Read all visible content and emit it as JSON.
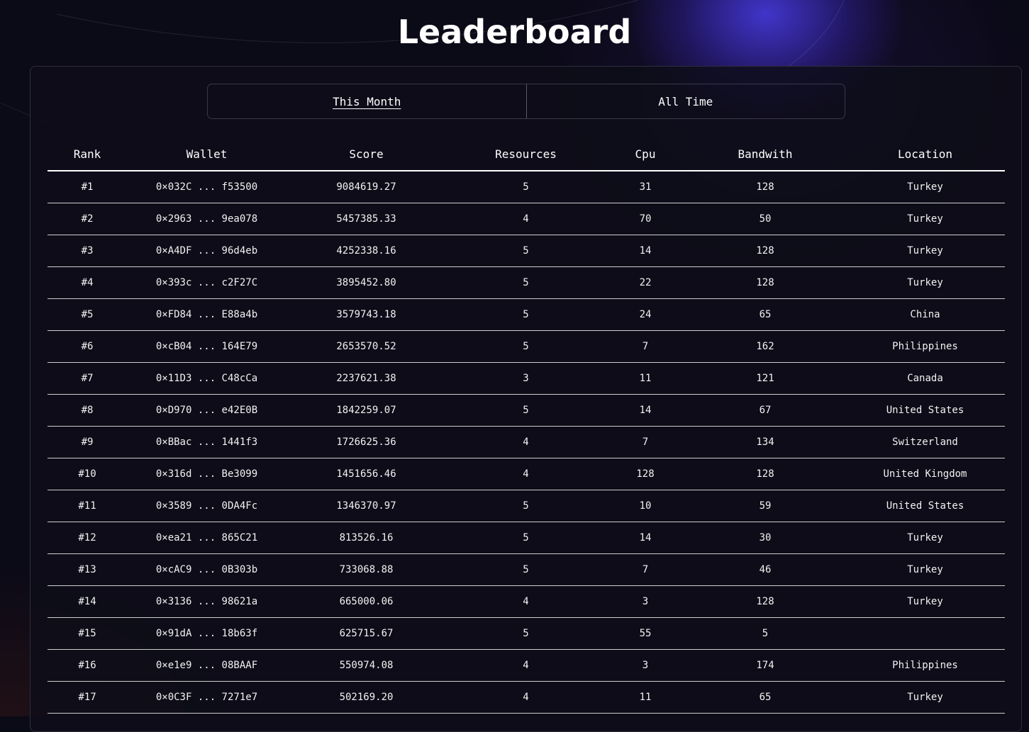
{
  "title": "Leaderboard",
  "tabs": [
    {
      "label": "This Month",
      "active": true
    },
    {
      "label": "All Time",
      "active": false
    }
  ],
  "columns": [
    "Rank",
    "Wallet",
    "Score",
    "Resources",
    "Cpu",
    "Bandwith",
    "Location"
  ],
  "rows": [
    {
      "rank": "#1",
      "wallet": "0×032C ... f53500",
      "score": "9084619.27",
      "resources": "5",
      "cpu": "31",
      "bandwith": "128",
      "location": "Turkey"
    },
    {
      "rank": "#2",
      "wallet": "0×2963 ... 9ea078",
      "score": "5457385.33",
      "resources": "4",
      "cpu": "70",
      "bandwith": "50",
      "location": "Turkey"
    },
    {
      "rank": "#3",
      "wallet": "0×A4DF ... 96d4eb",
      "score": "4252338.16",
      "resources": "5",
      "cpu": "14",
      "bandwith": "128",
      "location": "Turkey"
    },
    {
      "rank": "#4",
      "wallet": "0×393c ... c2F27C",
      "score": "3895452.80",
      "resources": "5",
      "cpu": "22",
      "bandwith": "128",
      "location": "Turkey"
    },
    {
      "rank": "#5",
      "wallet": "0×FD84 ... E88a4b",
      "score": "3579743.18",
      "resources": "5",
      "cpu": "24",
      "bandwith": "65",
      "location": "China"
    },
    {
      "rank": "#6",
      "wallet": "0×cB04 ... 164E79",
      "score": "2653570.52",
      "resources": "5",
      "cpu": "7",
      "bandwith": "162",
      "location": "Philippines"
    },
    {
      "rank": "#7",
      "wallet": "0×11D3 ... C48cCa",
      "score": "2237621.38",
      "resources": "3",
      "cpu": "11",
      "bandwith": "121",
      "location": "Canada"
    },
    {
      "rank": "#8",
      "wallet": "0×D970 ... e42E0B",
      "score": "1842259.07",
      "resources": "5",
      "cpu": "14",
      "bandwith": "67",
      "location": "United States"
    },
    {
      "rank": "#9",
      "wallet": "0×BBac ... 1441f3",
      "score": "1726625.36",
      "resources": "4",
      "cpu": "7",
      "bandwith": "134",
      "location": "Switzerland"
    },
    {
      "rank": "#10",
      "wallet": "0×316d ... Be3099",
      "score": "1451656.46",
      "resources": "4",
      "cpu": "128",
      "bandwith": "128",
      "location": "United Kingdom"
    },
    {
      "rank": "#11",
      "wallet": "0×3589 ... 0DA4Fc",
      "score": "1346370.97",
      "resources": "5",
      "cpu": "10",
      "bandwith": "59",
      "location": "United States"
    },
    {
      "rank": "#12",
      "wallet": "0×ea21 ... 865C21",
      "score": "813526.16",
      "resources": "5",
      "cpu": "14",
      "bandwith": "30",
      "location": "Turkey"
    },
    {
      "rank": "#13",
      "wallet": "0×cAC9 ... 0B303b",
      "score": "733068.88",
      "resources": "5",
      "cpu": "7",
      "bandwith": "46",
      "location": "Turkey"
    },
    {
      "rank": "#14",
      "wallet": "0×3136 ... 98621a",
      "score": "665000.06",
      "resources": "4",
      "cpu": "3",
      "bandwith": "128",
      "location": "Turkey"
    },
    {
      "rank": "#15",
      "wallet": "0×91dA ... 18b63f",
      "score": "625715.67",
      "resources": "5",
      "cpu": "55",
      "bandwith": "5",
      "location": ""
    },
    {
      "rank": "#16",
      "wallet": "0×e1e9 ... 08BAAF",
      "score": "550974.08",
      "resources": "4",
      "cpu": "3",
      "bandwith": "174",
      "location": "Philippines"
    },
    {
      "rank": "#17",
      "wallet": "0×0C3F ... 7271e7",
      "score": "502169.20",
      "resources": "4",
      "cpu": "11",
      "bandwith": "65",
      "location": "Turkey"
    }
  ]
}
